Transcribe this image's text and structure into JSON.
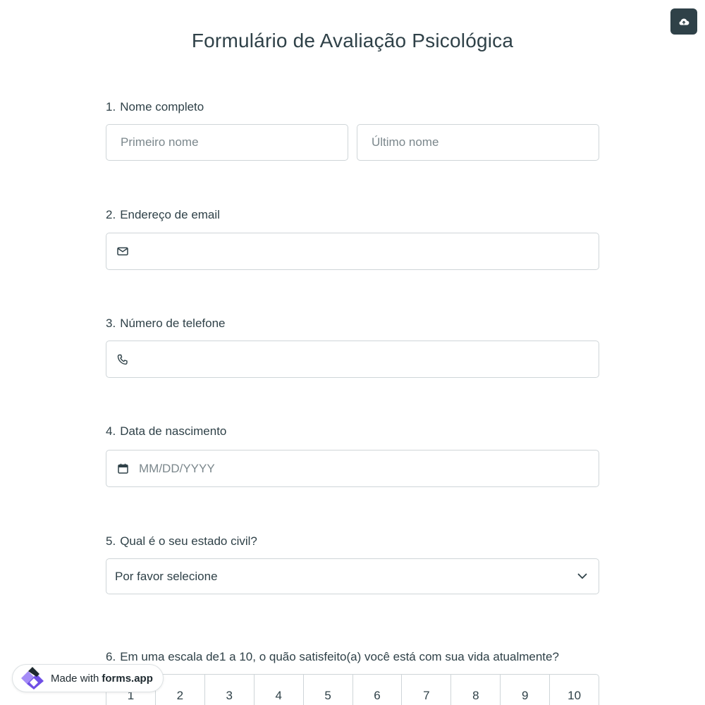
{
  "header": {
    "title": "Formulário de Avaliação Psicológica",
    "upload_icon": "cloud-upload-icon"
  },
  "questions": {
    "q1": {
      "number": "1.",
      "label": "Nome completo",
      "first_placeholder": "Primeiro nome",
      "last_placeholder": "Último nome"
    },
    "q2": {
      "number": "2.",
      "label": "Endereço de email",
      "icon": "envelope-icon",
      "value": ""
    },
    "q3": {
      "number": "3.",
      "label": "Número de telefone",
      "icon": "phone-icon",
      "value": ""
    },
    "q4": {
      "number": "4.",
      "label": "Data de nascimento",
      "icon": "calendar-icon",
      "placeholder": "MM/DD/YYYY"
    },
    "q5": {
      "number": "5.",
      "label": "Qual é o seu estado civil?",
      "selected": "Por favor selecione",
      "icon": "chevron-down-icon"
    },
    "q6": {
      "number": "6.",
      "label": "Em uma escala de1 a 10, o quão satisfeito(a) você está com sua vida atualmente?",
      "options": [
        "1",
        "2",
        "3",
        "4",
        "5",
        "6",
        "7",
        "8",
        "9",
        "10"
      ]
    }
  },
  "footer_badge": {
    "prefix": "Made with",
    "brand": "forms.app"
  },
  "colors": {
    "text": "#2f4148",
    "border": "#cfd5d8",
    "button_bg": "#2f4148",
    "logo_purple": "#7b5cf0"
  }
}
